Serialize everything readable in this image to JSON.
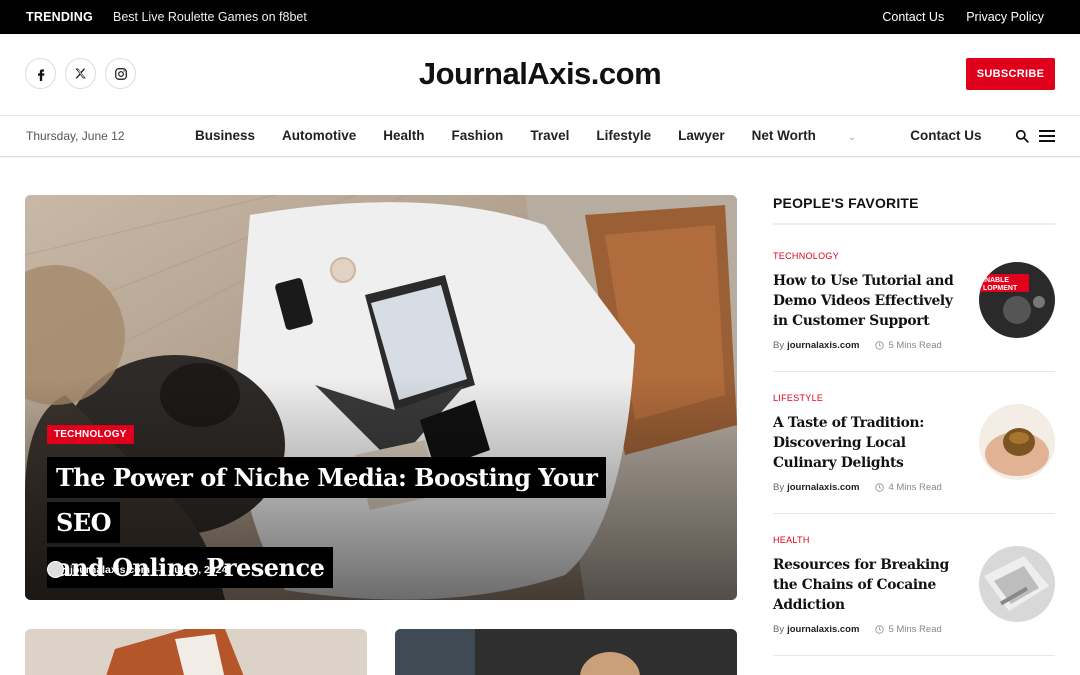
{
  "topbar": {
    "trending_label": "TRENDING",
    "ticker_text": "Best Live Roulette Games on f8bet",
    "links": [
      "Contact Us",
      "Privacy Policy"
    ]
  },
  "header": {
    "logo": "JournalAxis.com",
    "social_icons": [
      "facebook-icon",
      "x-twitter-icon",
      "instagram-icon"
    ],
    "subscribe_label": "SUBSCRIBE",
    "accent_color": "#e0001b"
  },
  "nav": {
    "date": "Thursday, June 12",
    "items": [
      "Business",
      "Automotive",
      "Health",
      "Fashion",
      "Travel",
      "Lifestyle",
      "Lawyer",
      "Net Worth",
      "Contact Us"
    ]
  },
  "hero": {
    "category": "TECHNOLOGY",
    "title_line1": "The Power of Niche Media: Boosting Your SEO",
    "title_line2": "and Online Presence",
    "author": "journalaxis.com",
    "separator": "—",
    "date": "July 6, 2024"
  },
  "sidebar": {
    "heading": "PEOPLE'S FAVORITE",
    "items": [
      {
        "category": "TECHNOLOGY",
        "title": "How to Use Tutorial and Demo Videos Effectively in Customer Support",
        "by": "By",
        "author": "journalaxis.com",
        "read": "5 Mins Read",
        "thumb_text": "INABLE\nLOPMENT"
      },
      {
        "category": "LIFESTYLE",
        "title": "A Taste of Tradition: Discovering Local Culinary Delights",
        "by": "By",
        "author": "journalaxis.com",
        "read": "4 Mins Read"
      },
      {
        "category": "HEALTH",
        "title": "Resources for Breaking the Chains of Cocaine Addiction",
        "by": "By",
        "author": "journalaxis.com",
        "read": "5 Mins Read"
      }
    ]
  }
}
